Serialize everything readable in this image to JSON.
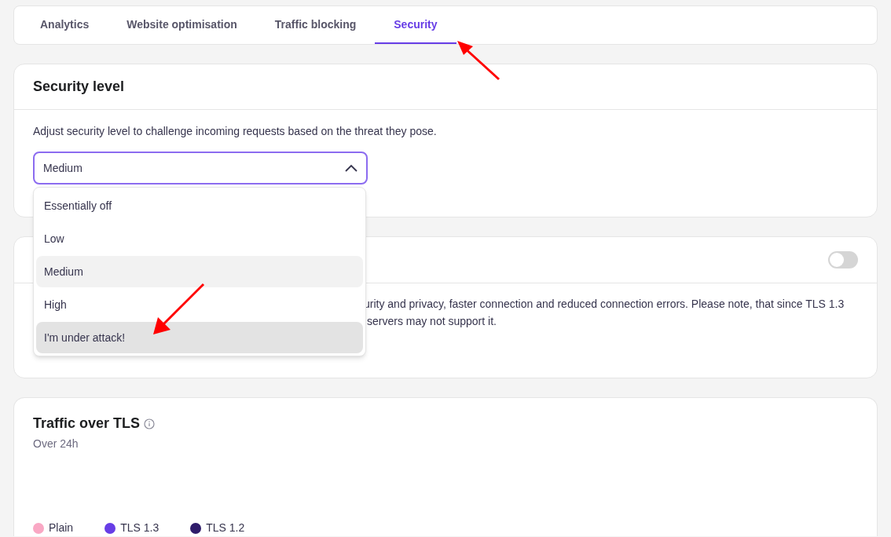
{
  "tabs": [
    {
      "label": "Analytics",
      "selected": false
    },
    {
      "label": "Website optimisation",
      "selected": false
    },
    {
      "label": "Traffic blocking",
      "selected": false
    },
    {
      "label": "Security",
      "selected": true
    }
  ],
  "security_level": {
    "title": "Security level",
    "description": "Adjust security level to challenge incoming requests based on the threat they pose.",
    "select": {
      "value": "Medium",
      "expanded": true,
      "options": [
        {
          "label": "Essentially off",
          "selected": false,
          "hovered": false
        },
        {
          "label": "Low",
          "selected": false,
          "hovered": false
        },
        {
          "label": "Medium",
          "selected": true,
          "hovered": false
        },
        {
          "label": "High",
          "selected": false,
          "hovered": false
        },
        {
          "label": "I'm under attack!",
          "selected": false,
          "hovered": true
        }
      ]
    }
  },
  "tls_card": {
    "toggle": {
      "on": false
    },
    "description_lines": [
      "urity and privacy, faster connection and reduced connection errors. Please note, that since TLS 1.3",
      "servers may not support it."
    ]
  },
  "traffic_card": {
    "title": "Traffic over TLS",
    "subtitle": "Over 24h",
    "legend": [
      {
        "label": "Plain",
        "color": "#f9a8c4"
      },
      {
        "label": "TLS 1.3",
        "color": "#673de6"
      },
      {
        "label": "TLS 1.2",
        "color": "#2f1c6a"
      }
    ]
  }
}
